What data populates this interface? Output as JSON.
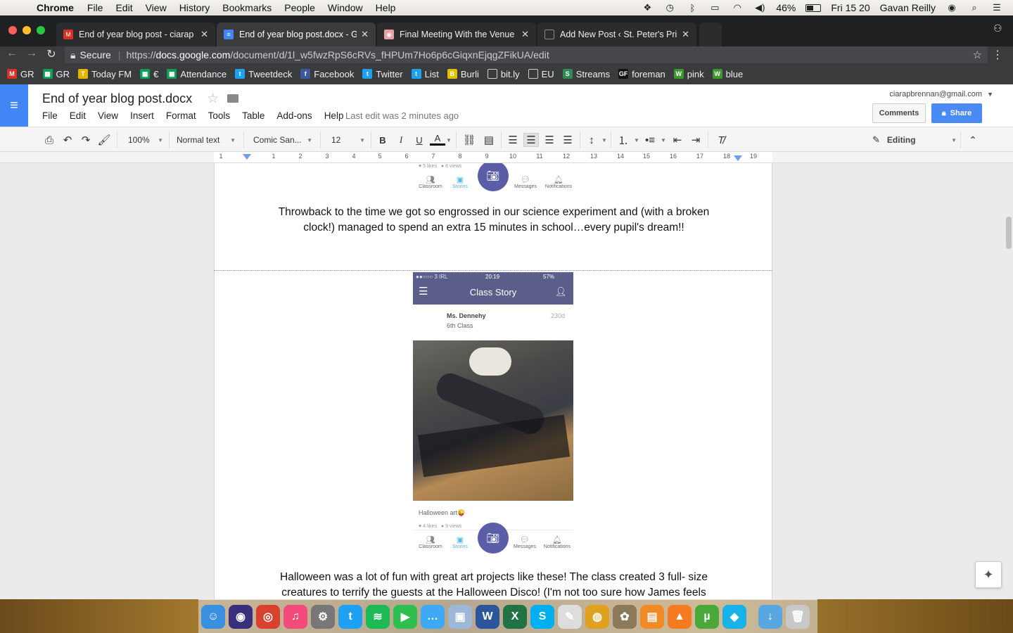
{
  "menubar": {
    "app": "Chrome",
    "items": [
      "File",
      "Edit",
      "View",
      "History",
      "Bookmarks",
      "People",
      "Window",
      "Help"
    ],
    "battery": "46%",
    "clock": "Fri 15 20",
    "user": "Gavan Reilly"
  },
  "tabs": [
    {
      "label": "End of year blog post - ciarap",
      "icon": "gmail-icon",
      "color": "#d93025"
    },
    {
      "label": "End of year blog post.docx - G",
      "icon": "docs-icon",
      "color": "#4285f4"
    },
    {
      "label": "Final Meeting With the Venue C",
      "icon": "venue-icon",
      "color": "#e8a0a0"
    },
    {
      "label": "Add New Post ‹ St. Peter's Prin",
      "icon": "page-icon",
      "color": "#888888"
    }
  ],
  "address": {
    "secure": "Secure",
    "scheme": "https://",
    "host": "docs.google.com",
    "path": "/document/d/1l_w5fwzRpS6cRVs_fHPUm7Ho6p6cGiqxnEjqgZFikUA/edit"
  },
  "bookmarks": [
    {
      "label": "GR",
      "icon": "gmail-icon",
      "color": "#d93025"
    },
    {
      "label": "GR",
      "icon": "sheets-icon",
      "color": "#0f9d58"
    },
    {
      "label": "Today FM",
      "icon": "todayfm-icon",
      "color": "#e8b400"
    },
    {
      "label": "€",
      "icon": "sheets-icon",
      "color": "#0f9d58"
    },
    {
      "label": "Attendance",
      "icon": "sheets-icon",
      "color": "#0f9d58"
    },
    {
      "label": "Tweetdeck",
      "icon": "tweetdeck-icon",
      "color": "#1da1f2"
    },
    {
      "label": "Facebook",
      "icon": "facebook-icon",
      "color": "#3b5998"
    },
    {
      "label": "Twitter",
      "icon": "twitter-icon",
      "color": "#1da1f2"
    },
    {
      "label": "List",
      "icon": "twitter-icon",
      "color": "#1da1f2"
    },
    {
      "label": "Burli",
      "icon": "burli-icon",
      "color": "#e0c000"
    },
    {
      "label": "bit.ly",
      "icon": "page-icon",
      "color": "#666666"
    },
    {
      "label": "EU",
      "icon": "folder-icon",
      "color": "#666666"
    },
    {
      "label": "Streams",
      "icon": "streams-icon",
      "color": "#2e8b57"
    },
    {
      "label": "foreman",
      "icon": "gf-icon",
      "color": "#111111"
    },
    {
      "label": "pink",
      "icon": "w-icon",
      "color": "#3a9a2a"
    },
    {
      "label": "blue",
      "icon": "w-icon",
      "color": "#3a9a2a"
    }
  ],
  "docs": {
    "title": "End of year blog post.docx",
    "menu": [
      "File",
      "Edit",
      "View",
      "Insert",
      "Format",
      "Tools",
      "Table",
      "Add-ons",
      "Help"
    ],
    "last_edit": "Last edit was 2 minutes ago",
    "account": "ciarapbrennan@gmail.com",
    "comments": "Comments",
    "share": "Share"
  },
  "toolbar": {
    "zoom": "100%",
    "style": "Normal text",
    "font": "Comic San...",
    "size": "12",
    "mode": "Editing"
  },
  "ruler": [
    "1",
    "1",
    "2",
    "3",
    "4",
    "5",
    "6",
    "7",
    "8",
    "9",
    "10",
    "11",
    "12",
    "13",
    "14",
    "15",
    "16",
    "17",
    "18",
    "19"
  ],
  "document": {
    "caption1_line1": "Throwback to the time we got so engrossed in our science experiment and (with a broken",
    "caption1_line2": "clock!) managed to spend an extra 15 minutes in school…every pupil's dream!!",
    "phone1": {
      "likes": "5 likes",
      "views": "8 views"
    },
    "phone2": {
      "carrier": "●●○○○ 3 IRL",
      "time": "20:19",
      "battery": "57%",
      "title": "Class Story",
      "teacher": "Ms. Dennehy",
      "class": "6th Class",
      "age": "230d",
      "post_text": "Halloween art😜",
      "likes": "4 likes",
      "views": "9 views"
    },
    "tabbar": [
      "Classroom",
      "Stories",
      "Messages",
      "Notifications"
    ],
    "caption2_line1": "Halloween was a lot of fun with great art projects like these! The class created 3 full- size",
    "caption2_line2": "creatures to terrify the guests at the Halloween Disco! (I'm not too sure how James feels"
  },
  "dock": [
    {
      "name": "finder-icon",
      "color": "#3b8fe0",
      "glyph": "☺"
    },
    {
      "name": "siri-icon",
      "color": "#3a2f7a",
      "glyph": "◉"
    },
    {
      "name": "chrome-icon",
      "color": "#d9412f",
      "glyph": "◎"
    },
    {
      "name": "itunes-icon",
      "color": "#f24b7b",
      "glyph": "♫"
    },
    {
      "name": "system-preferences-icon",
      "color": "#777777",
      "glyph": "⚙"
    },
    {
      "name": "twitter-icon",
      "color": "#1da1f2",
      "glyph": "t"
    },
    {
      "name": "spotify-icon",
      "color": "#1db954",
      "glyph": "≋"
    },
    {
      "name": "facetime-icon",
      "color": "#2fbf4f",
      "glyph": "▶"
    },
    {
      "name": "messages-icon",
      "color": "#3fa9f5",
      "glyph": "…"
    },
    {
      "name": "preview-icon",
      "color": "#9db7d6",
      "glyph": "▣"
    },
    {
      "name": "word-icon",
      "color": "#2b579a",
      "glyph": "W"
    },
    {
      "name": "excel-icon",
      "color": "#217346",
      "glyph": "X"
    },
    {
      "name": "skype-icon",
      "color": "#00aff0",
      "glyph": "S"
    },
    {
      "name": "textedit-icon",
      "color": "#dddddd",
      "glyph": "✎"
    },
    {
      "name": "podcast-icon",
      "color": "#e0a020",
      "glyph": "◍"
    },
    {
      "name": "gimp-icon",
      "color": "#8a7a5a",
      "glyph": "✿"
    },
    {
      "name": "ibooks-icon",
      "color": "#f08a24",
      "glyph": "▤"
    },
    {
      "name": "vlc-icon",
      "color": "#f47b20",
      "glyph": "▲"
    },
    {
      "name": "utorrent-icon",
      "color": "#4aa83a",
      "glyph": "µ"
    },
    {
      "name": "kodi-icon",
      "color": "#17b2e8",
      "glyph": "◆"
    },
    {
      "name": "downloads-icon",
      "color": "#5aa6e0",
      "glyph": "↓"
    },
    {
      "name": "trash-icon",
      "color": "#c8c8c8",
      "glyph": "🗑"
    }
  ]
}
